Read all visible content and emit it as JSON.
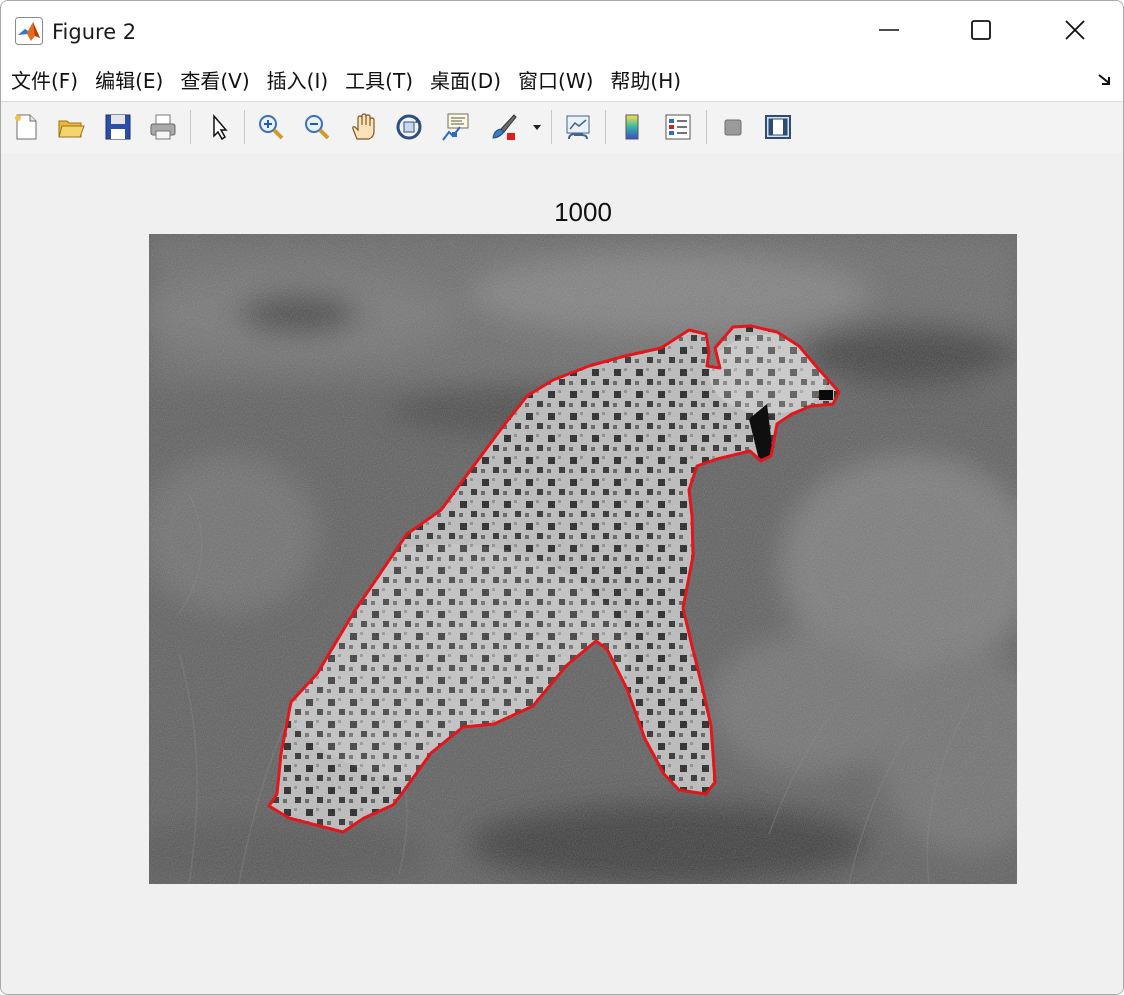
{
  "window": {
    "title": "Figure 2",
    "controls": [
      "minimize-icon",
      "maximize-icon",
      "close-icon"
    ]
  },
  "menubar": {
    "items": [
      {
        "label": "文件(F)"
      },
      {
        "label": "编辑(E)"
      },
      {
        "label": "查看(V)"
      },
      {
        "label": "插入(I)"
      },
      {
        "label": "工具(T)"
      },
      {
        "label": "桌面(D)"
      },
      {
        "label": "窗口(W)"
      },
      {
        "label": "帮助(H)"
      }
    ]
  },
  "toolbar": {
    "buttons": [
      "new-figure-icon",
      "open-file-icon",
      "save-icon",
      "print-icon",
      "edit-plot-arrow-icon",
      "zoom-in-icon",
      "zoom-out-icon",
      "pan-hand-icon",
      "rotate-3d-icon",
      "data-cursor-icon",
      "brush-icon",
      "brush-dropdown-icon",
      "link-plot-icon",
      "insert-colorbar-icon",
      "insert-legend-icon",
      "hide-plot-tools-icon",
      "show-plot-tools-icon"
    ]
  },
  "axes": {
    "title": "1000",
    "image": "grayscale photo of a sitting cheetah with red segmentation contour",
    "contour_color": "#e3161b"
  },
  "colors": {
    "window_bg": "#f0f0f0",
    "titlebar_bg": "#ffffff"
  }
}
